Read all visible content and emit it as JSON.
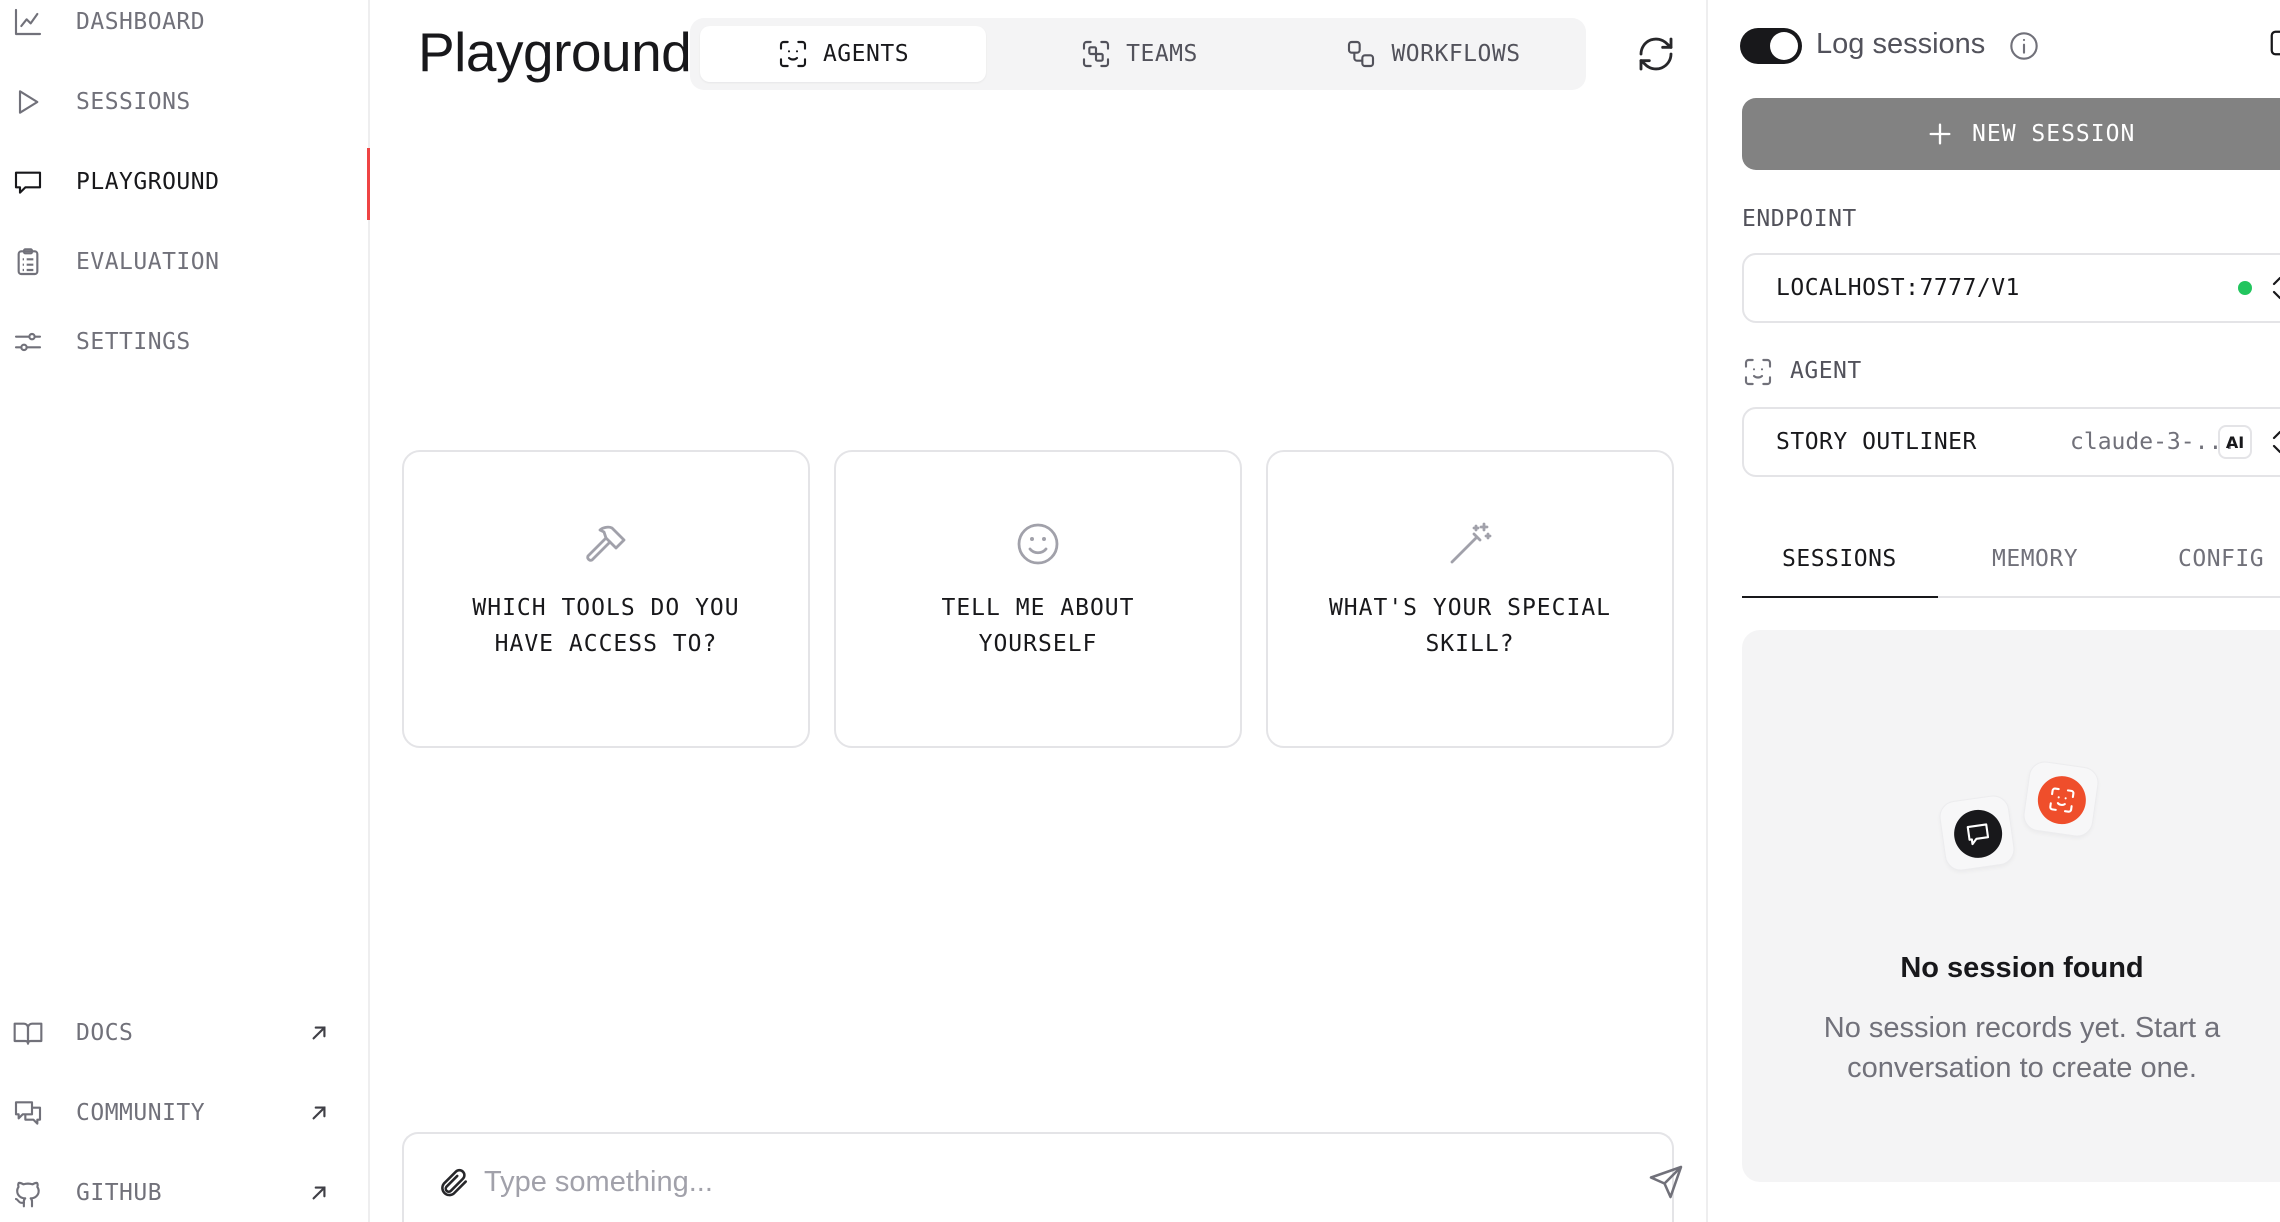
{
  "sidebar": {
    "top_items": [
      {
        "label": "DASHBOARD",
        "icon": "chart-line-icon"
      },
      {
        "label": "SESSIONS",
        "icon": "play-icon"
      },
      {
        "label": "PLAYGROUND",
        "icon": "message-square-icon",
        "active": true
      },
      {
        "label": "EVALUATION",
        "icon": "clipboard-list-icon"
      },
      {
        "label": "SETTINGS",
        "icon": "sliders-icon"
      }
    ],
    "bottom_items": [
      {
        "label": "DOCS",
        "icon": "book-open-icon",
        "external": true
      },
      {
        "label": "COMMUNITY",
        "icon": "messages-icon",
        "external": true
      },
      {
        "label": "GITHUB",
        "icon": "github-icon",
        "external": true
      }
    ],
    "active_color": "#ef4444"
  },
  "main": {
    "title": "Playground",
    "mode_tabs": [
      {
        "label": "AGENTS",
        "icon": "scan-face-icon",
        "active": true
      },
      {
        "label": "TEAMS",
        "icon": "team-scan-icon"
      },
      {
        "label": "WORKFLOWS",
        "icon": "workflow-icon"
      }
    ],
    "suggestions": [
      {
        "text": "WHICH TOOLS DO YOU HAVE ACCESS TO?",
        "icon": "hammer-icon"
      },
      {
        "text": "TELL ME ABOUT YOURSELF",
        "icon": "smile-icon"
      },
      {
        "text": "WHAT'S YOUR SPECIAL SKILL?",
        "icon": "magic-wand-icon"
      }
    ],
    "chat_input": {
      "placeholder": "Type something..."
    }
  },
  "right_panel": {
    "log_sessions_label": "Log sessions",
    "log_sessions_enabled": true,
    "new_session_label": "NEW SESSION",
    "endpoint_label": "ENDPOINT",
    "endpoint_value": "LOCALHOST:7777/V1",
    "endpoint_status_color": "#22c55e",
    "agent_label": "AGENT",
    "agent_value": "STORY OUTLINER",
    "agent_model": "claude-3-...",
    "model_badge": "AI",
    "tabs": [
      {
        "label": "SESSIONS",
        "active": true
      },
      {
        "label": "MEMORY"
      },
      {
        "label": "CONFIG"
      }
    ],
    "empty_state": {
      "title": "No session found",
      "description": "No session records yet. Start a conversation to create one."
    },
    "accent_color": "#ef4e2b"
  }
}
